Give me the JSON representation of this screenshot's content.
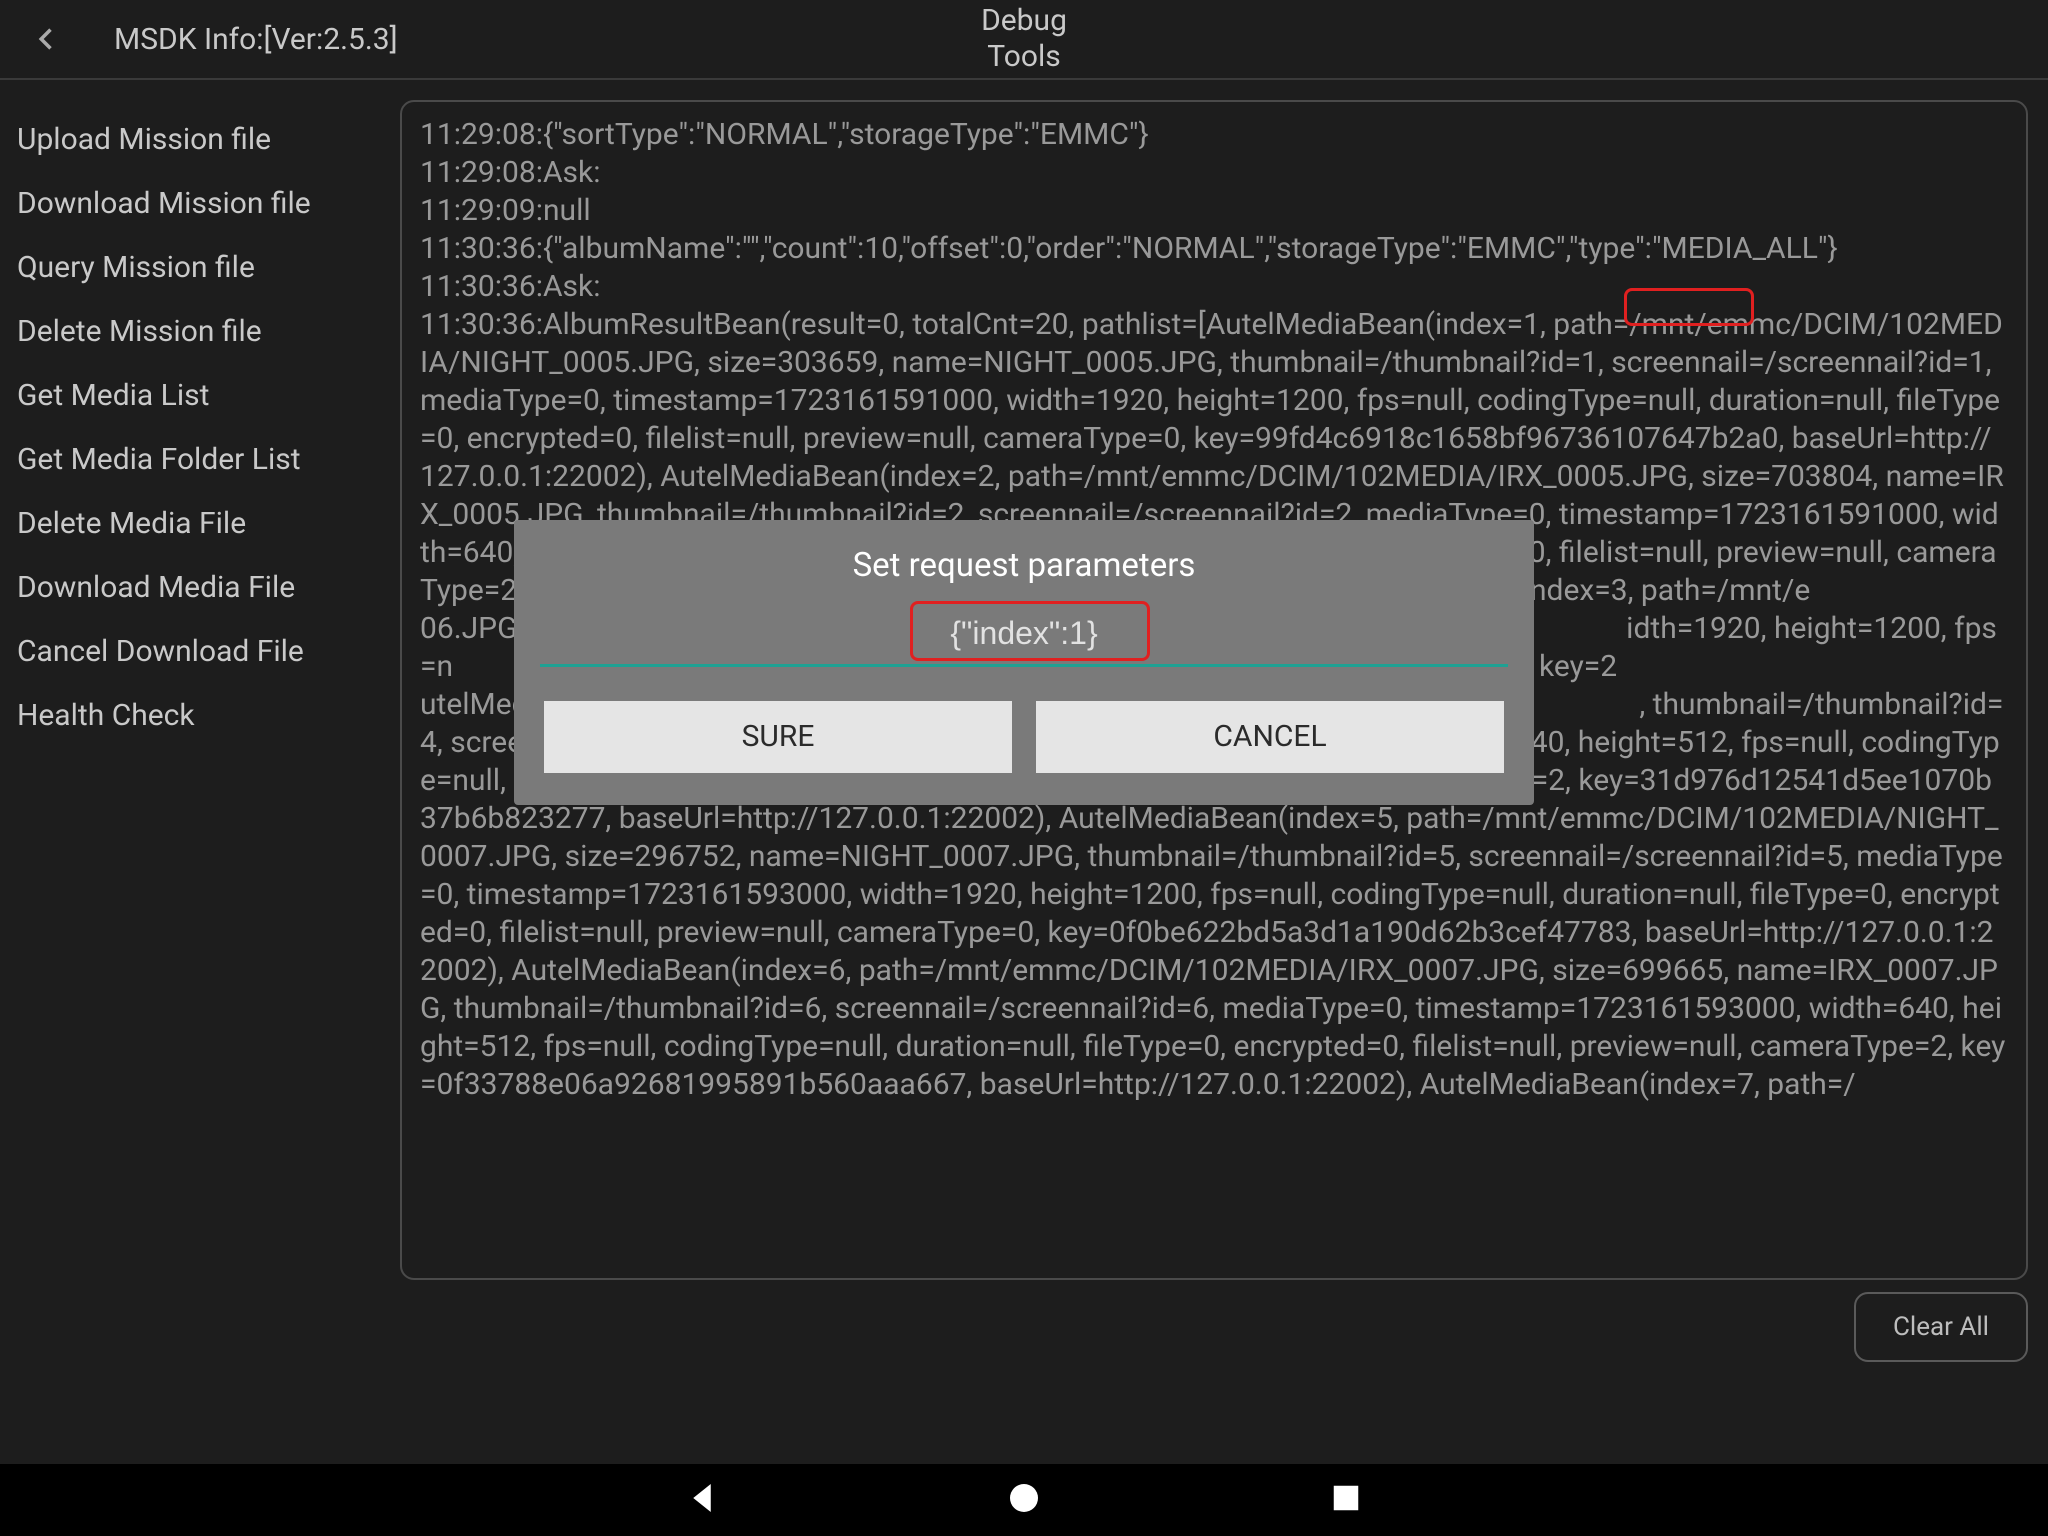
{
  "header": {
    "msdk_info": "MSDK Info:[Ver:2.5.3]",
    "title_line1": "Debug",
    "title_line2": "Tools"
  },
  "sidebar": {
    "items": [
      "Upload Mission file",
      "Download Mission file",
      "Query Mission file",
      "Delete Mission file",
      "Get Media List",
      "Get Media Folder List",
      "Delete Media File",
      "Download Media File",
      "Cancel Download File",
      "Health Check"
    ]
  },
  "console_text": "11:29:08:{\"sortType\":\"NORMAL\",\"storageType\":\"EMMC\"}\n11:29:08:Ask:\n11:29:09:null\n11:30:36:{\"albumName\":\"\",\"count\":10,\"offset\":0,\"order\":\"NORMAL\",\"storageType\":\"EMMC\",\"type\":\"MEDIA_ALL\"}\n11:30:36:Ask:\n11:30:36:AlbumResultBean(result=0, totalCnt=20, pathlist=[AutelMediaBean(index=1, path=/mnt/emmc/DCIM/102MEDIA/NIGHT_0005.JPG, size=303659, name=NIGHT_0005.JPG, thumbnail=/thumbnail?id=1, screennail=/screennail?id=1, mediaType=0, timestamp=1723161591000, width=1920, height=1200, fps=null, codingType=null, duration=null, fileType=0, encrypted=0, filelist=null, preview=null, cameraType=0, key=99fd4c6918c1658bf96736107647b2a0, baseUrl=http://127.0.0.1:22002), AutelMediaBean(index=2, path=/mnt/emmc/DCIM/102MEDIA/IRX_0005.JPG, size=703804, name=IRX_0005.JPG, thumbnail=/thumbnail?id=2, screennail=/screennail?id=2, mediaType=0, timestamp=1723161591000, width=640, height=512, fps=null, codingType=null, duration=null, fileType=0, encrypted=0, filelist=null, preview=null, cameraType=2, key=c                                                                                                 telMediaBean(index=3, path=/mnt/e                                                                                                 06.JPG, thumbnail=/thumbnail?id=3,                                                                                                 idth=1920, height=1200, fps=n                                                                                                 eview=null, cameraType=0, key=2                                                                                                 utelMediaBean(index=4, path=/mnt/e                                                                                                 , thumbnail=/thumbnail?id=4, screennail=/screennail?id=4, mediaType=0, timestamp=1723161592000, width=640, height=512, fps=null, codingType=null, duration=null, fileType=0, encrypted=0, filelist=null, preview=null, cameraType=2, key=31d976d12541d5ee1070b37b6b823277, baseUrl=http://127.0.0.1:22002), AutelMediaBean(index=5, path=/mnt/emmc/DCIM/102MEDIA/NIGHT_0007.JPG, size=296752, name=NIGHT_0007.JPG, thumbnail=/thumbnail?id=5, screennail=/screennail?id=5, mediaType=0, timestamp=1723161593000, width=1920, height=1200, fps=null, codingType=null, duration=null, fileType=0, encrypted=0, filelist=null, preview=null, cameraType=0, key=0f0be622bd5a3d1a190d62b3cef47783, baseUrl=http://127.0.0.1:22002), AutelMediaBean(index=6, path=/mnt/emmc/DCIM/102MEDIA/IRX_0007.JPG, size=699665, name=IRX_0007.JPG, thumbnail=/thumbnail?id=6, screennail=/screennail?id=6, mediaType=0, timestamp=1723161593000, width=640, height=512, fps=null, codingType=null, duration=null, fileType=0, encrypted=0, filelist=null, preview=null, cameraType=2, key=0f33788e06a92681995891b560aaa667, baseUrl=http://127.0.0.1:22002), AutelMediaBean(index=7, path=/",
  "clear_label": "Clear All",
  "dialog": {
    "title": "Set request parameters",
    "input_value": "{\"index\":1}",
    "sure_label": "SURE",
    "cancel_label": "CANCEL"
  },
  "highlight_annotation": "index=1"
}
